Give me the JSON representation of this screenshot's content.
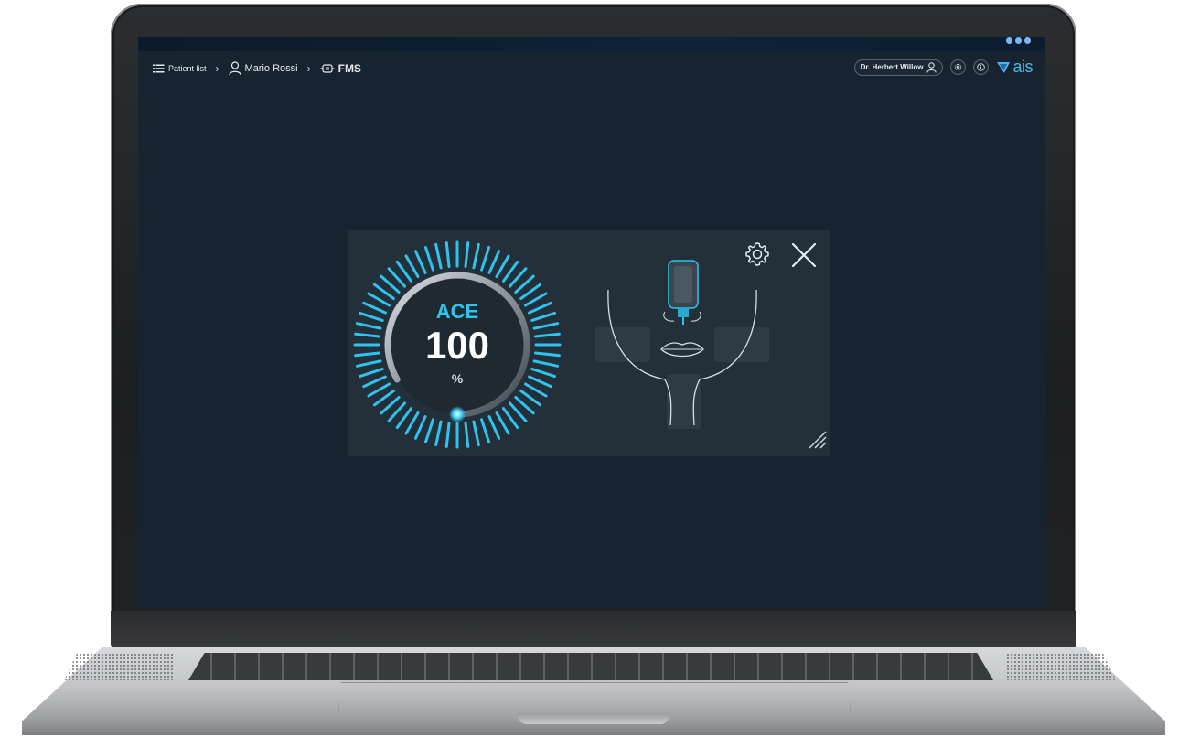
{
  "breadcrumb": {
    "patient_list": "Patient list",
    "patient_name": "Mario Rossi",
    "section": "FMS"
  },
  "header": {
    "user_name": "Dr. Herbert Willow",
    "logo_text": "ais"
  },
  "gauge": {
    "label": "ACE",
    "value": "100",
    "unit": "%",
    "level": 1.0
  },
  "icons": {
    "list": "list-icon",
    "user": "user-icon",
    "device": "sensor-icon",
    "settings": "gear-icon",
    "info": "info-icon",
    "close": "close-icon",
    "resize": "resize-icon"
  },
  "colors": {
    "accent": "#2ec4ef",
    "screen_bg": "#17232f",
    "panel_bg": "#233039",
    "logo": "#4fb7e8"
  }
}
